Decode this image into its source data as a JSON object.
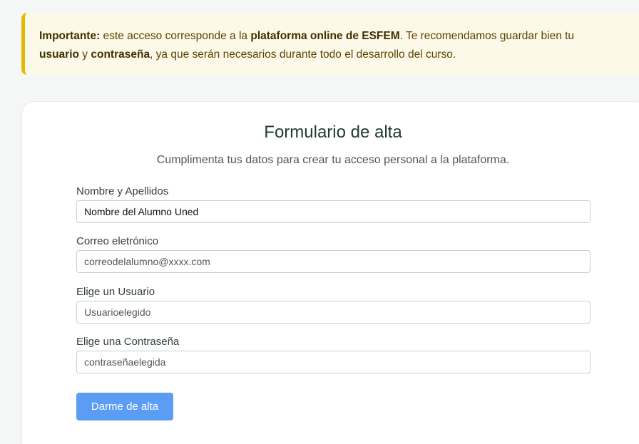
{
  "notice": {
    "parts": [
      {
        "text": "Importante:",
        "bold": true
      },
      {
        "text": " este acceso corresponde a la ",
        "bold": false
      },
      {
        "text": "plataforma online de ESFEM",
        "bold": true
      },
      {
        "text": ". Te recomendamos guardar bien tu ",
        "bold": false
      },
      {
        "text": "usuario",
        "bold": true
      },
      {
        "text": " y ",
        "bold": false
      },
      {
        "text": "contraseña",
        "bold": true
      },
      {
        "text": ", ya que serán necesarios durante todo el desarrollo del curso.",
        "bold": false
      }
    ],
    "accent_color": "#e6b800"
  },
  "form": {
    "title": "Formulario de alta",
    "subtitle": "Cumplimenta tus datos para crear tu acceso personal a la plataforma.",
    "fields": [
      {
        "label": "Nombre y Apellidos",
        "value": "Nombre del Alumno Uned"
      },
      {
        "label": "Correo eletrónico",
        "value": "correodelalumno@xxxx.com"
      },
      {
        "label": "Elige un Usuario",
        "value": "Usuarioelegido"
      },
      {
        "label": "Elige una Contraseña",
        "value": "contraseñaelegida"
      }
    ],
    "submit_label": "Darme de alta",
    "button_color": "#5b9cf5"
  }
}
